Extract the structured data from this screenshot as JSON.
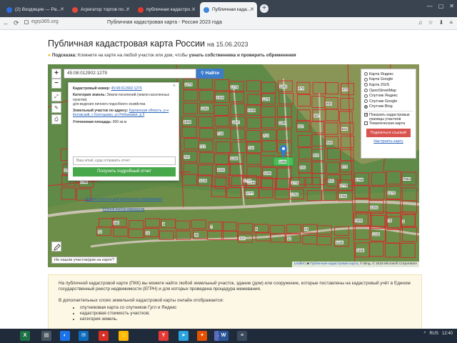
{
  "browser": {
    "tabs": [
      {
        "label": "(2) Входящие — Рамблер/",
        "color": "#2a6edb",
        "active": false
      },
      {
        "label": "Агрегатор торгов по бан",
        "color": "#e44b3a",
        "active": false
      },
      {
        "label": "публичная кадастровая к",
        "color": "#e33b2e",
        "active": false
      },
      {
        "label": "Публичная кадастровая",
        "color": "#3c8ad8",
        "active": true
      }
    ],
    "new_tab": "+",
    "url": "egrp365.org",
    "address_title": "Публичная кадастровая карта - Россия 2023 года",
    "nav": {
      "back": "←",
      "forward": "→",
      "reload": "⟳"
    }
  },
  "page": {
    "title": "Публичная кадастровая карта России",
    "title_date": "на 15.06.2023",
    "hint_label": "Подсказка:",
    "hint_text": " Кликните на карте на любой участок или дом, чтобы ",
    "hint_bold": "узнать собственника и проверить обременения"
  },
  "map": {
    "search_value": "45:08:012902:1279",
    "search_button": "Найти",
    "zoom_in": "+",
    "zoom_out": "−",
    "popup": {
      "close": "×",
      "cad_label": "Кадастровый номер:",
      "cad_value": "45:08:012902:1279",
      "cat_label": "Категория земель:",
      "cat_value": "Земли поселений (земли населенных пунктов)",
      "use_value": "для ведения личного подсобного хозяйства",
      "addr_label": "Земельный участок по адресу:",
      "addr_value": "Курганская область, р-н Кетовский, с Колташево, ул Рябиновая, д 3",
      "area_label": "Уточненная площадь:",
      "area_value": "800 кв.м",
      "email_placeholder": "Ваш email, куда отправить отчет",
      "get_button": "Получить подробный отчет",
      "more_link": "Детали отчета и дополнительная информация",
      "manual_link": "Ручной выбор вариантов"
    },
    "layers": {
      "options": [
        {
          "label": "Карта Яндекс",
          "on": false
        },
        {
          "label": "Карта Google",
          "on": false
        },
        {
          "label": "Карта 2GIS",
          "on": false
        },
        {
          "label": "OpenStreetMap",
          "on": false
        },
        {
          "label": "Спутник Яндекс",
          "on": false
        },
        {
          "label": "Спутник Google",
          "on": false
        },
        {
          "label": "Спутник Bing",
          "on": true
        }
      ],
      "check1": "Показать кадастровые границы участков",
      "check2": "Тематическая карта",
      "check1_on": true,
      "check2_on": false,
      "share_button": "Поделиться ссылкой",
      "configure_link": "Настроить карту"
    },
    "not_found": "Не нашли участок/дом на карте?",
    "attribution_a": "Leaflet",
    "attribution_b": "Публичная кадастровая карта",
    "attribution_c": ", © Bing, © 2018 Microsoft Corporation",
    "parcel_labels": [
      "1276",
      "1279",
      "1282",
      "1283",
      "1278",
      "1341",
      "1339",
      "1340",
      "1347",
      "1280",
      "718",
      "713",
      "717",
      "720",
      "737",
      "1158",
      "1209",
      "1222",
      "1226",
      "1229",
      "1246",
      "474",
      "473",
      "480",
      "487",
      "537",
      "531",
      "536",
      "533",
      "532",
      "573",
      "541",
      "496",
      "4",
      "7",
      "5",
      "13",
      "52",
      "32",
      "48",
      "114",
      "92",
      "1145",
      "1774",
      "1776",
      "1778",
      "1777",
      "1762",
      "1764",
      "1765",
      "1766",
      "1769",
      "7564",
      "1275",
      "1292",
      "1300",
      "2",
      "75",
      "1226",
      "1155"
    ],
    "colors": {
      "satellite": "#5f8a48",
      "boundary": "#d42a2a",
      "road": "#c9c2b0",
      "selected": "#3ad65c",
      "marker": "#2a7bd6"
    }
  },
  "info": {
    "p1": "На публичной кадастровой карте (ПКК) вы можете найти любой земельный участок, здание (дом) или сооружение, которые поставлены на кадастровый учёт в Едином государственный реестр недвижимости (ЕГРН) и для которых проведена процедура межевания.",
    "p2": "В дополнительных слоях земельной кадастровой карты онлайн отображается:",
    "items": [
      "спутниковая карта со спутников Гугл и Яндекс",
      "кадастровая стоимость участков;",
      "категория земель."
    ]
  },
  "taskbar": {
    "icons": [
      {
        "label": "X",
        "color": "#1e7145"
      },
      {
        "label": "▤",
        "color": "#4a5562"
      },
      {
        "label": "◐",
        "color": "#1a73e8"
      },
      {
        "label": "✉",
        "color": "#0f6cbd"
      },
      {
        "label": "●",
        "color": "#d93025"
      },
      {
        "label": "□",
        "color": "#ffb900"
      },
      {
        "label": "Y",
        "color": "#e53935"
      },
      {
        "label": "➤",
        "color": "#2aa3df"
      },
      {
        "label": "✦",
        "color": "#e65100"
      },
      {
        "label": "⌂",
        "color": "#5c6bc0"
      },
      {
        "label": "W",
        "color": "#2b579a"
      },
      {
        "label": "≡",
        "color": "#3b4a5c"
      }
    ],
    "tray": [
      "^",
      "RUS",
      "12:40"
    ]
  }
}
